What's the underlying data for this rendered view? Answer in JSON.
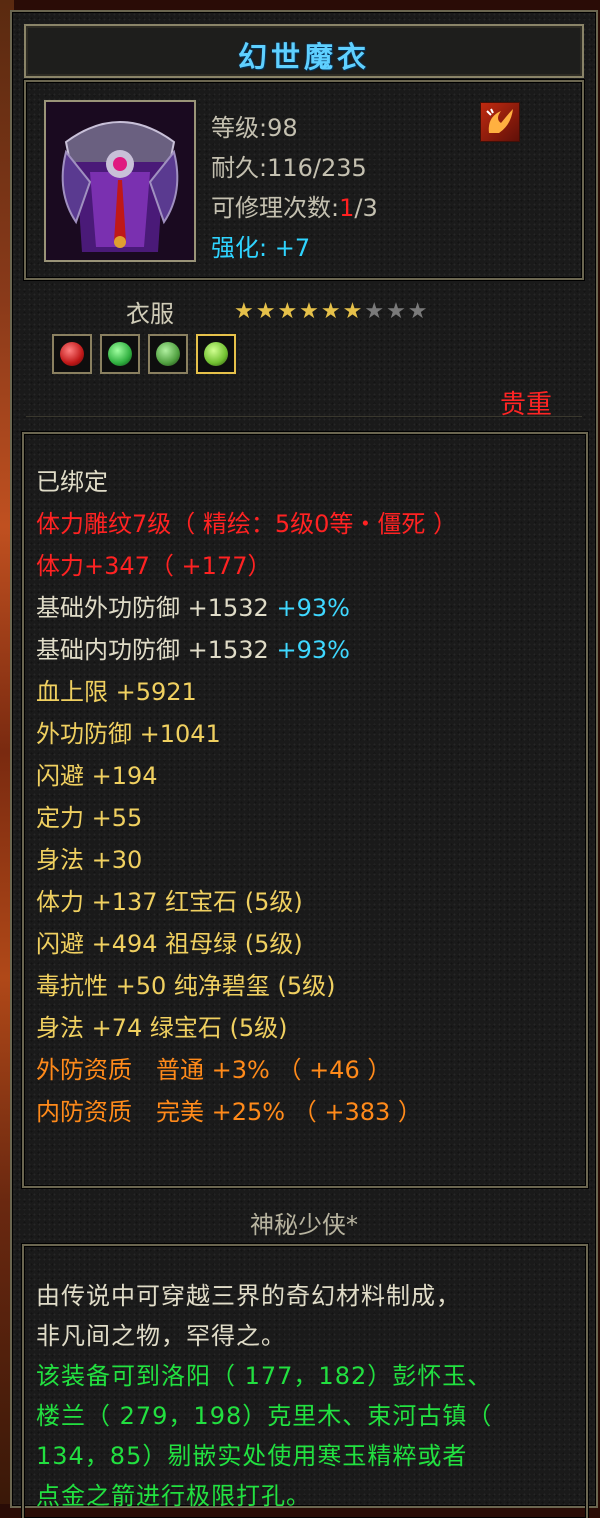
{
  "item": {
    "name": "幻世魔衣",
    "level": "等级:98",
    "durability": "耐久:116/235",
    "repair_prefix": "可修理次数:",
    "repair_used": "1",
    "repair_total": "/3",
    "strengthen_label": "强化:",
    "strengthen_value": "+7",
    "type": "衣服",
    "stars_filled": 6,
    "stars_total": 9,
    "stars_on": "★★★★★★",
    "stars_off": "★★★",
    "rarity": "贵重",
    "gems": [
      {
        "name": "ruby-gem",
        "color": "#d02020"
      },
      {
        "name": "emerald-gem",
        "color": "#30b040"
      },
      {
        "name": "jade-gem",
        "color": "#50a040"
      },
      {
        "name": "green-gem",
        "color": "#70c030"
      }
    ]
  },
  "attributes": {
    "bound": "已绑定",
    "engrave": "体力雕纹7级（ 精绘：5级0等・僵死 ）",
    "vit_main": "体力+347（ +177）",
    "ext_def_base": {
      "label": "基础外功防御 +1532",
      "pct": "+93%"
    },
    "int_def_base": {
      "label": "基础内功防御 +1532",
      "pct": "+93%"
    },
    "hp_max": "血上限 +5921",
    "ext_def": "外功防御 +1041",
    "dodge": "闪避 +194",
    "focus": "定力 +55",
    "agility": "身法 +30",
    "gem_lines": [
      "体力 +137 红宝石 (5级)",
      "闪避 +494 祖母绿 (5级)",
      "毒抗性 +50 纯净碧玺 (5级)",
      "身法 +74 绿宝石 (5级)"
    ],
    "quality_ext": "外防资质　普通 +3% （ +46 ）",
    "quality_int": "内防资质　完美 +25% （ +383 ）"
  },
  "author": "神秘少侠*",
  "description": {
    "flavor_1": "由传说中可穿越三界的奇幻材料制成，",
    "flavor_2": "非凡间之物，罕得之。",
    "hint_1": "该装备可到洛阳（ 177，182）彭怀玉、",
    "hint_2": "楼兰（ 279，198）克里木、束河古镇（",
    "hint_3": "134，85）剔嵌实处使用寒玉精粹或者",
    "hint_4": "点金之箭进行极限打孔。"
  }
}
